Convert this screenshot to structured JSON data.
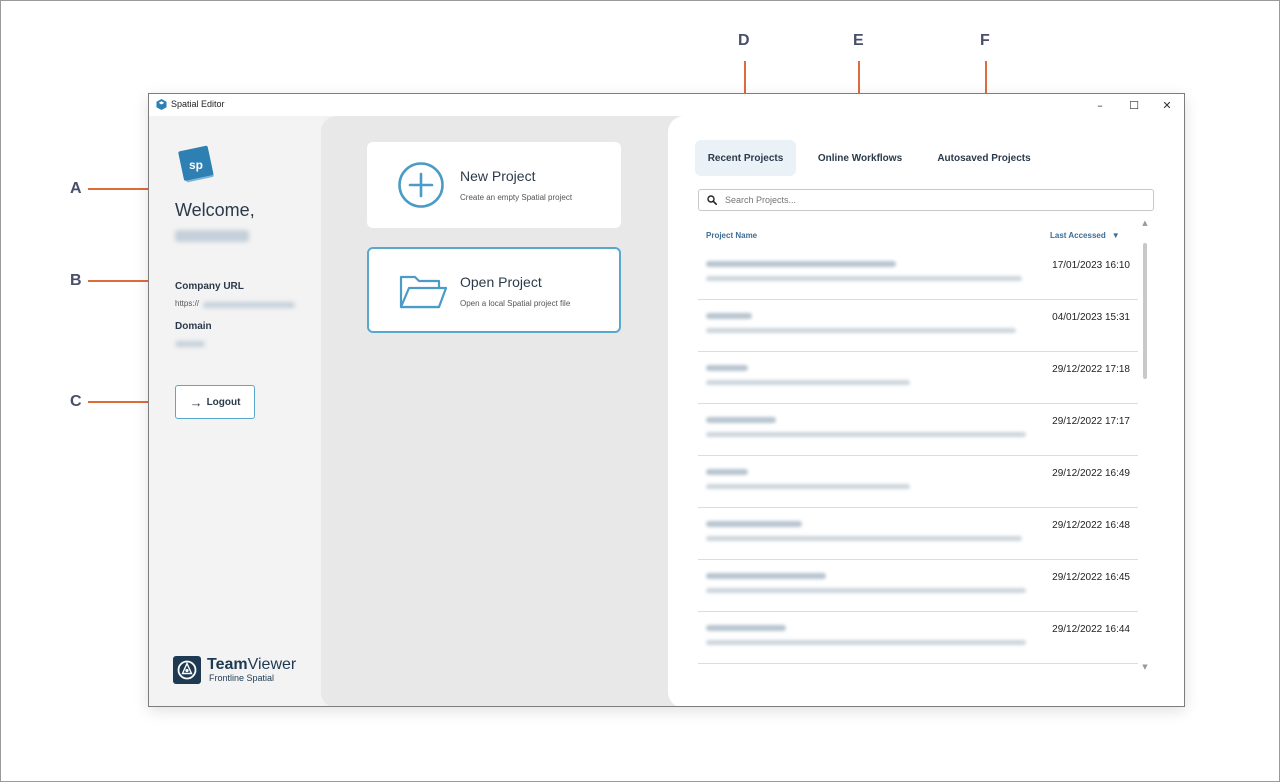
{
  "callouts": {
    "a": "A",
    "b": "B",
    "c": "C",
    "d": "D",
    "e": "E",
    "f": "F"
  },
  "window": {
    "title": "Spatial Editor",
    "minimize_glyph": "–",
    "maximize_glyph": "☐",
    "close_glyph": "✕"
  },
  "sidebar": {
    "logo_text": "sp",
    "welcome": "Welcome,",
    "company_url_label": "Company URL",
    "company_url_value": "https://",
    "domain_label": "Domain",
    "logout_label": "Logout",
    "logout_icon": "→",
    "brand_main_bold": "Team",
    "brand_main_rest": "Viewer",
    "brand_sub": "Frontline Spatial"
  },
  "actions": {
    "new_project_title": "New Project",
    "new_project_sub": "Create an empty Spatial project",
    "open_project_title": "Open Project",
    "open_project_sub": "Open a local Spatial project file"
  },
  "tabs": [
    {
      "label": "Recent Projects",
      "active": true
    },
    {
      "label": "Online Workflows",
      "active": false
    },
    {
      "label": "Autosaved Projects",
      "active": false
    }
  ],
  "search": {
    "placeholder": "Search Projects..."
  },
  "table": {
    "col_name": "Project Name",
    "col_accessed": "Last Accessed",
    "sort_icon": "▼",
    "rows": [
      {
        "date": "17/01/2023 16:10"
      },
      {
        "date": "04/01/2023 15:31"
      },
      {
        "date": "29/12/2022 17:18"
      },
      {
        "date": "29/12/2022 17:17"
      },
      {
        "date": "29/12/2022 16:49"
      },
      {
        "date": "29/12/2022 16:48"
      },
      {
        "date": "29/12/2022 16:45"
      },
      {
        "date": "29/12/2022 16:44"
      }
    ]
  },
  "colors": {
    "accent": "#5aa7cc",
    "callout": "#e06b3a",
    "heading": "#2b3a4a",
    "link": "#3c6e96"
  }
}
